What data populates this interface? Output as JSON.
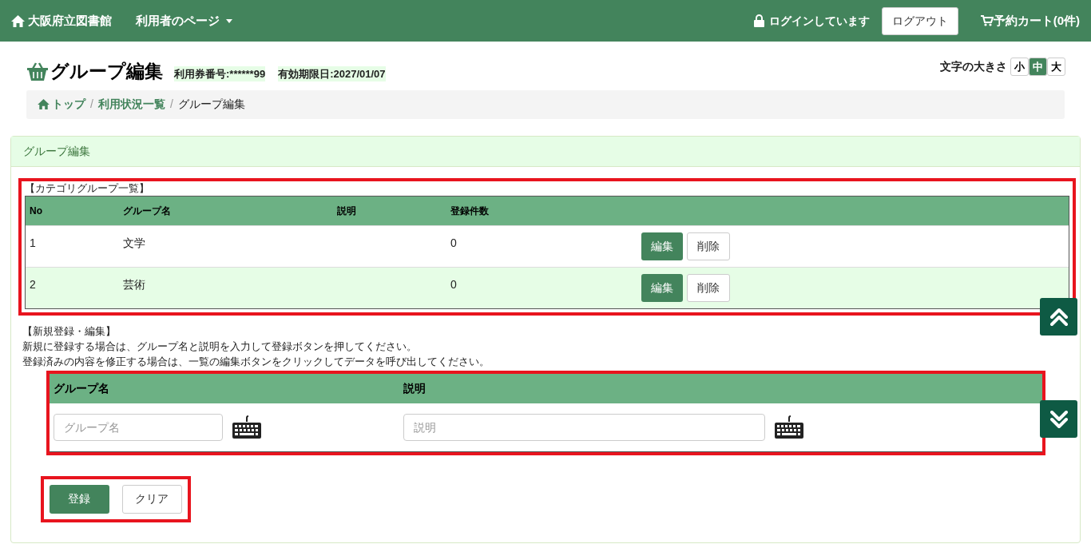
{
  "header": {
    "home": "大阪府立図書館",
    "menu": "利用者のページ",
    "login_status": "ログインしています",
    "logout": "ログアウト",
    "cart": "予約カート(0件)"
  },
  "page": {
    "title": "グループ編集",
    "card_number": "利用券番号:******99",
    "expiry": "有効期限日:2027/01/07"
  },
  "font_size": {
    "label": "文字の大きさ",
    "options": [
      {
        "label": "小",
        "selected": false
      },
      {
        "label": "中",
        "selected": true
      },
      {
        "label": "大",
        "selected": false
      }
    ]
  },
  "breadcrumb": [
    {
      "label": "トップ",
      "current": false,
      "separator": "/"
    },
    {
      "label": "利用状況一覧",
      "current": false,
      "separator": "/"
    },
    {
      "label": "グループ編集",
      "current": true
    }
  ],
  "panel": {
    "title": "グループ編集",
    "list": {
      "heading": "【カテゴリグループ一覧】",
      "columns": [
        "No",
        "グループ名",
        "説明",
        "登録件数"
      ],
      "rows": [
        {
          "no": "1",
          "name": "文学",
          "count": "0",
          "actions": [
            "編集",
            "削除"
          ]
        },
        {
          "no": "2",
          "name": "芸術",
          "count": "0",
          "actions": [
            "編集",
            "削除"
          ]
        }
      ]
    },
    "form": {
      "heading": "【新規登録・編集】",
      "instructions": [
        "新規に登録する場合は、グループ名と説明を入力して登録ボタンを押してください。",
        "登録済みの内容を修正する場合は、一覧の編集ボタンをクリックしてデータを呼び出してください。"
      ],
      "columns": [
        "グループ名",
        "説明"
      ],
      "fields": [
        {
          "placeholder": "グループ名"
        },
        {
          "placeholder": "説明"
        }
      ],
      "buttons": [
        {
          "label": "登録",
          "kind": "primary"
        },
        {
          "label": "クリア",
          "kind": "default"
        }
      ]
    }
  }
}
